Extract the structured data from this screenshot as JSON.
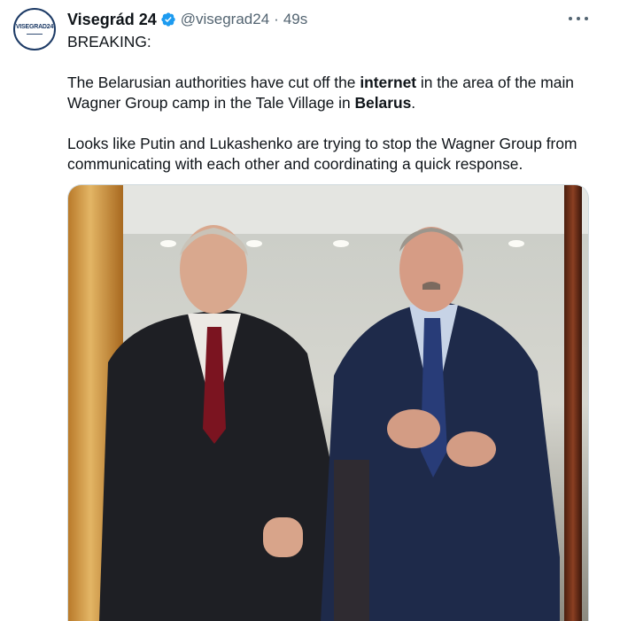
{
  "account": {
    "display_name": "Visegrád 24",
    "handle": "@visegrad24",
    "time_sep": "·",
    "elapsed": "49s",
    "avatar_logo": "VISEGRAD24",
    "verified": true,
    "verified_color": "#1d9bf0"
  },
  "tweet": {
    "line1": "BREAKING:",
    "p1_pre": "The Belarusian authorities have cut off the ",
    "p1_bold1": "internet",
    "p1_mid": " in the area of the main Wagner Group camp in the Tale Village in ",
    "p1_bold2": "Belarus",
    "p1_post": ".",
    "p2": "Looks like Putin and Lukashenko are trying to stop the Wagner Group from communicating with each other and coordinating a quick response."
  },
  "icons": {
    "more": "more-horizontal-icon",
    "verified": "verified-badge-icon"
  }
}
